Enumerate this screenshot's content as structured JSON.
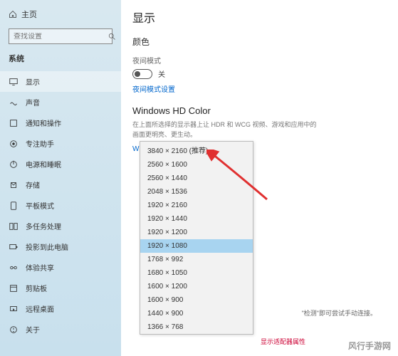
{
  "home": {
    "label": "主页"
  },
  "search": {
    "placeholder": "查找设置"
  },
  "category": "系统",
  "sidebar": {
    "items": [
      {
        "label": "显示"
      },
      {
        "label": "声音"
      },
      {
        "label": "通知和操作"
      },
      {
        "label": "专注助手"
      },
      {
        "label": "电源和睡眠"
      },
      {
        "label": "存储"
      },
      {
        "label": "平板模式"
      },
      {
        "label": "多任务处理"
      },
      {
        "label": "投影到此电脑"
      },
      {
        "label": "体验共享"
      },
      {
        "label": "剪贴板"
      },
      {
        "label": "远程桌面"
      },
      {
        "label": "关于"
      }
    ]
  },
  "main": {
    "title": "显示",
    "color_section": "颜色",
    "night_mode": "夜间模式",
    "toggle_state": "关",
    "night_link": "夜间模式设置",
    "hdr_title": "Windows HD Color",
    "hdr_desc1": "在上面所选择的显示器上让 HDR 和 WCG 视频、游戏和应用中的画面更明亮、更生动。",
    "hdr_link": "Windows HD Color 设置",
    "right_hint": "\"检测\"即可尝试手动连接。",
    "bottom_link": "显示适配器属性"
  },
  "dropdown": {
    "items": [
      "3840 × 2160 (推荐)",
      "2560 × 1600",
      "2560 × 1440",
      "2048 × 1536",
      "1920 × 2160",
      "1920 × 1440",
      "1920 × 1200",
      "1920 × 1080",
      "1768 × 992",
      "1680 × 1050",
      "1600 × 1200",
      "1600 × 900",
      "1440 × 900",
      "1366 × 768"
    ],
    "selected_index": 7
  },
  "watermark": "风行手游网"
}
